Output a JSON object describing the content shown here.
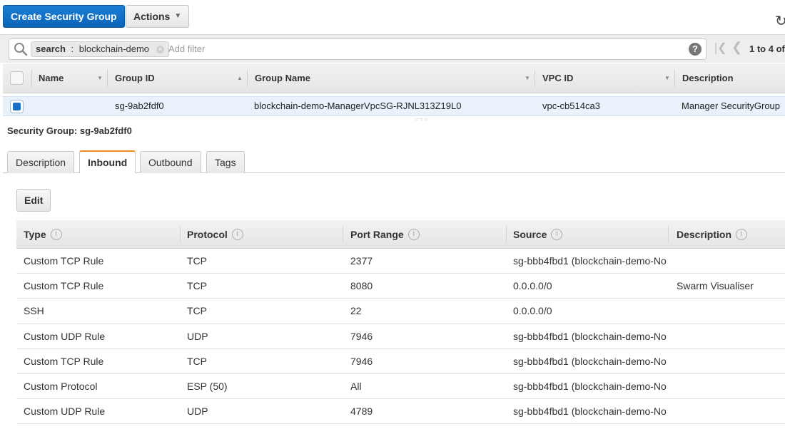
{
  "toolbar": {
    "create_label": "Create Security Group",
    "actions_label": "Actions",
    "actions_icon": "chevron-down-icon",
    "refresh_icon": "refresh-icon"
  },
  "filter": {
    "token_key": "search",
    "token_sep": " : ",
    "token_value": "blockchain-demo",
    "placeholder": "Add filter",
    "help_glyph": "?"
  },
  "pager": {
    "text": "1 to 4 of"
  },
  "sg_table": {
    "columns": [
      "Name",
      "Group ID",
      "Group Name",
      "VPC ID",
      "Description"
    ],
    "rows": [
      {
        "selected": true,
        "name": "",
        "group_id": "sg-9ab2fdf0",
        "group_name": "blockchain-demo-ManagerVpcSG-RJNL313Z19L0",
        "vpc_id": "vpc-cb514ca3",
        "description": "Manager SecurityGroup"
      }
    ]
  },
  "details": {
    "title": "Security Group: sg-9ab2fdf0",
    "tabs": [
      {
        "label": "Description",
        "active": false
      },
      {
        "label": "Inbound",
        "active": true
      },
      {
        "label": "Outbound",
        "active": false
      },
      {
        "label": "Tags",
        "active": false
      }
    ],
    "edit_label": "Edit"
  },
  "rules": {
    "columns": [
      "Type",
      "Protocol",
      "Port Range",
      "Source",
      "Description"
    ],
    "rows": [
      [
        "Custom TCP Rule",
        "TCP",
        "2377",
        "sg-bbb4fbd1 (blockchain-demo-No",
        ""
      ],
      [
        "Custom TCP Rule",
        "TCP",
        "8080",
        "0.0.0.0/0",
        "Swarm Visualiser"
      ],
      [
        "SSH",
        "TCP",
        "22",
        "0.0.0.0/0",
        ""
      ],
      [
        "Custom UDP Rule",
        "UDP",
        "7946",
        "sg-bbb4fbd1 (blockchain-demo-No",
        ""
      ],
      [
        "Custom TCP Rule",
        "TCP",
        "7946",
        "sg-bbb4fbd1 (blockchain-demo-No",
        ""
      ],
      [
        "Custom Protocol",
        "ESP (50)",
        "All",
        "sg-bbb4fbd1 (blockchain-demo-No",
        ""
      ],
      [
        "Custom UDP Rule",
        "UDP",
        "4789",
        "sg-bbb4fbd1 (blockchain-demo-No",
        ""
      ]
    ]
  },
  "colors": {
    "primary": "#0b64b8",
    "active_tab_accent": "#f08a24",
    "selected_row": "#e9f2fb"
  }
}
